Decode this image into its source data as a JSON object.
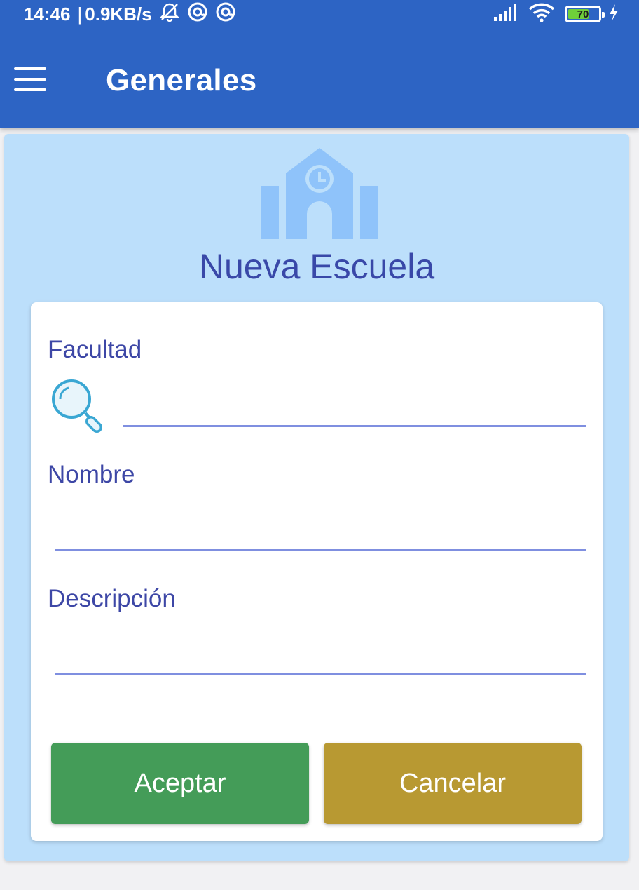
{
  "status_bar": {
    "time": "14:46",
    "separator": "|",
    "network_speed": "0.9KB/s",
    "battery_level": "70",
    "battery_fraction": 0.7,
    "icons": [
      "bell-off-icon",
      "at-sign-icon",
      "at-sign-icon",
      "signal-icon",
      "wifi-icon",
      "battery-icon",
      "charging-bolt-icon"
    ]
  },
  "app_bar": {
    "title": "Generales",
    "menu_icon": "hamburger-menu-icon"
  },
  "page": {
    "title": "Nueva Escuela",
    "header_icon": "school-icon"
  },
  "form": {
    "facultad": {
      "label": "Facultad",
      "value": "",
      "placeholder": "",
      "icon": "search-icon"
    },
    "nombre": {
      "label": "Nombre",
      "value": "",
      "placeholder": ""
    },
    "descripcion": {
      "label": "Descripción",
      "value": "",
      "placeholder": ""
    }
  },
  "actions": {
    "accept_label": "Aceptar",
    "cancel_label": "Cancelar"
  },
  "colors": {
    "app_bar": "#2d64c4",
    "panel_background": "#bcdffb",
    "accent_text": "#3d47a6",
    "accept": "#449c58",
    "cancel": "#b89932"
  }
}
